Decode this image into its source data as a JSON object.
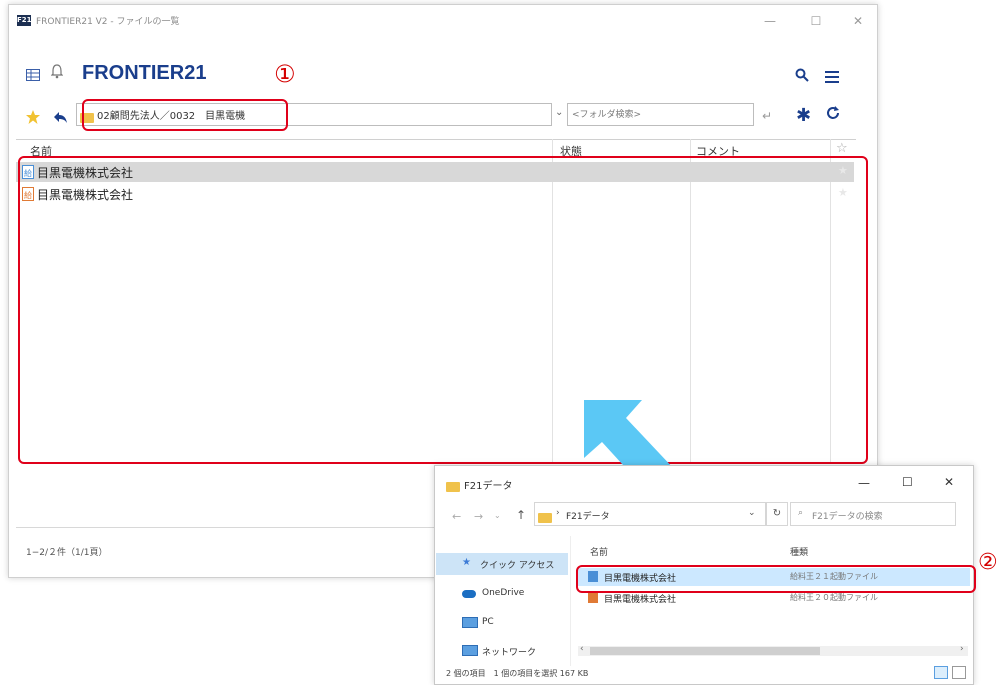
{
  "main": {
    "title": "FRONTIER21 V2 - ファイルの一覧",
    "app_icon_text": "F21",
    "minimize": "—",
    "maximize": "☐",
    "close": "✕",
    "brand": "FRONTIER21",
    "callout": "①",
    "path": "02顧問先法人／0032　目黒電機",
    "folder_search_placeholder": "<フォルダ検索>",
    "columns": {
      "name": "名前",
      "status": "状態",
      "comment": "コメント"
    },
    "rows": [
      {
        "name": "目黒電機株式会社"
      },
      {
        "name": "目黒電機株式会社"
      }
    ],
    "footer": "1−2/２件（1/1頁）"
  },
  "explorer": {
    "title": "F21データ",
    "breadcrumb": "F21データ",
    "search_placeholder": "F21データの検索",
    "col_name": "名前",
    "col_type": "種類",
    "nav": [
      "クイック アクセス",
      "OneDrive",
      "PC",
      "ネットワーク"
    ],
    "files": [
      {
        "name": "目黒電機株式会社",
        "type": "給料王２１起動ファイル"
      },
      {
        "name": "目黒電機株式会社",
        "type": "給料王２０起動ファイル"
      }
    ],
    "status": "2 個の項目　1 個の項目を選択  167 KB",
    "callout": "②"
  },
  "colors": {
    "red": "#e0001a",
    "arrow": "#5bc8f5",
    "brand": "#1a3e8c"
  }
}
